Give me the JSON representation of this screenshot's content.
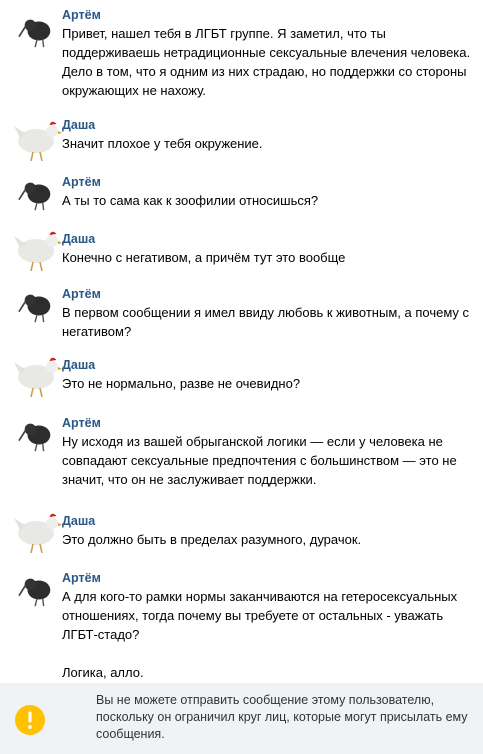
{
  "messages": [
    {
      "author": "Артём",
      "avatar_icon": "kiwi-bird-icon",
      "lines": [
        "Привет, нашел тебя в ЛГБТ группе. Я заметил, что ты поддерживаешь нетрадиционные сексуальные влечения человека. Дело в том, что я одним из них страдаю, но поддержки со стороны окружающих не нахожу."
      ]
    },
    {
      "author": "Даша",
      "avatar_icon": "hen-icon",
      "lines": [
        "Значит плохое у тебя окружение."
      ]
    },
    {
      "author": "Артём",
      "avatar_icon": "kiwi-bird-icon",
      "lines": [
        "А ты то сама как к зоофилии относишься?"
      ]
    },
    {
      "author": "Даша",
      "avatar_icon": "hen-icon",
      "lines": [
        "Конечно с негативом, а причём тут это вообще"
      ]
    },
    {
      "author": "Артём",
      "avatar_icon": "kiwi-bird-icon",
      "lines": [
        "В первом сообщении я имел ввиду любовь к животным, а почему с негативом?"
      ]
    },
    {
      "author": "Даша",
      "avatar_icon": "hen-icon",
      "lines": [
        "Это не нормально, разве не очевидно?"
      ]
    },
    {
      "author": "Артём",
      "avatar_icon": "kiwi-bird-icon",
      "lines": [
        "Ну исходя из вашей обрыганской логики — если у человека не совпадают сексуальные предпочтения с большинством — это не значит, что он не заслуживает поддержки."
      ]
    },
    {
      "author": "Даша",
      "avatar_icon": "hen-icon",
      "lines": [
        "Это должно быть в пределах разумного, дурачок."
      ]
    },
    {
      "author": "Артём",
      "avatar_icon": "kiwi-bird-icon",
      "lines": [
        "А для кого-то рамки нормы заканчиваются на гетеросексуальных отношениях, тогда почему вы требуете от остальных - уважать ЛГБТ-стадо?",
        "Логика, алло."
      ]
    }
  ],
  "footer": {
    "icon": "warning-icon",
    "accent_color": "#ffc200",
    "text": "Вы не можете отправить сообщение этому пользователю, поскольку он ограничил круг лиц, которые могут присылать ему сообщения."
  },
  "colors": {
    "author": "#2a5885",
    "footer_bg": "#f0f2f5"
  }
}
